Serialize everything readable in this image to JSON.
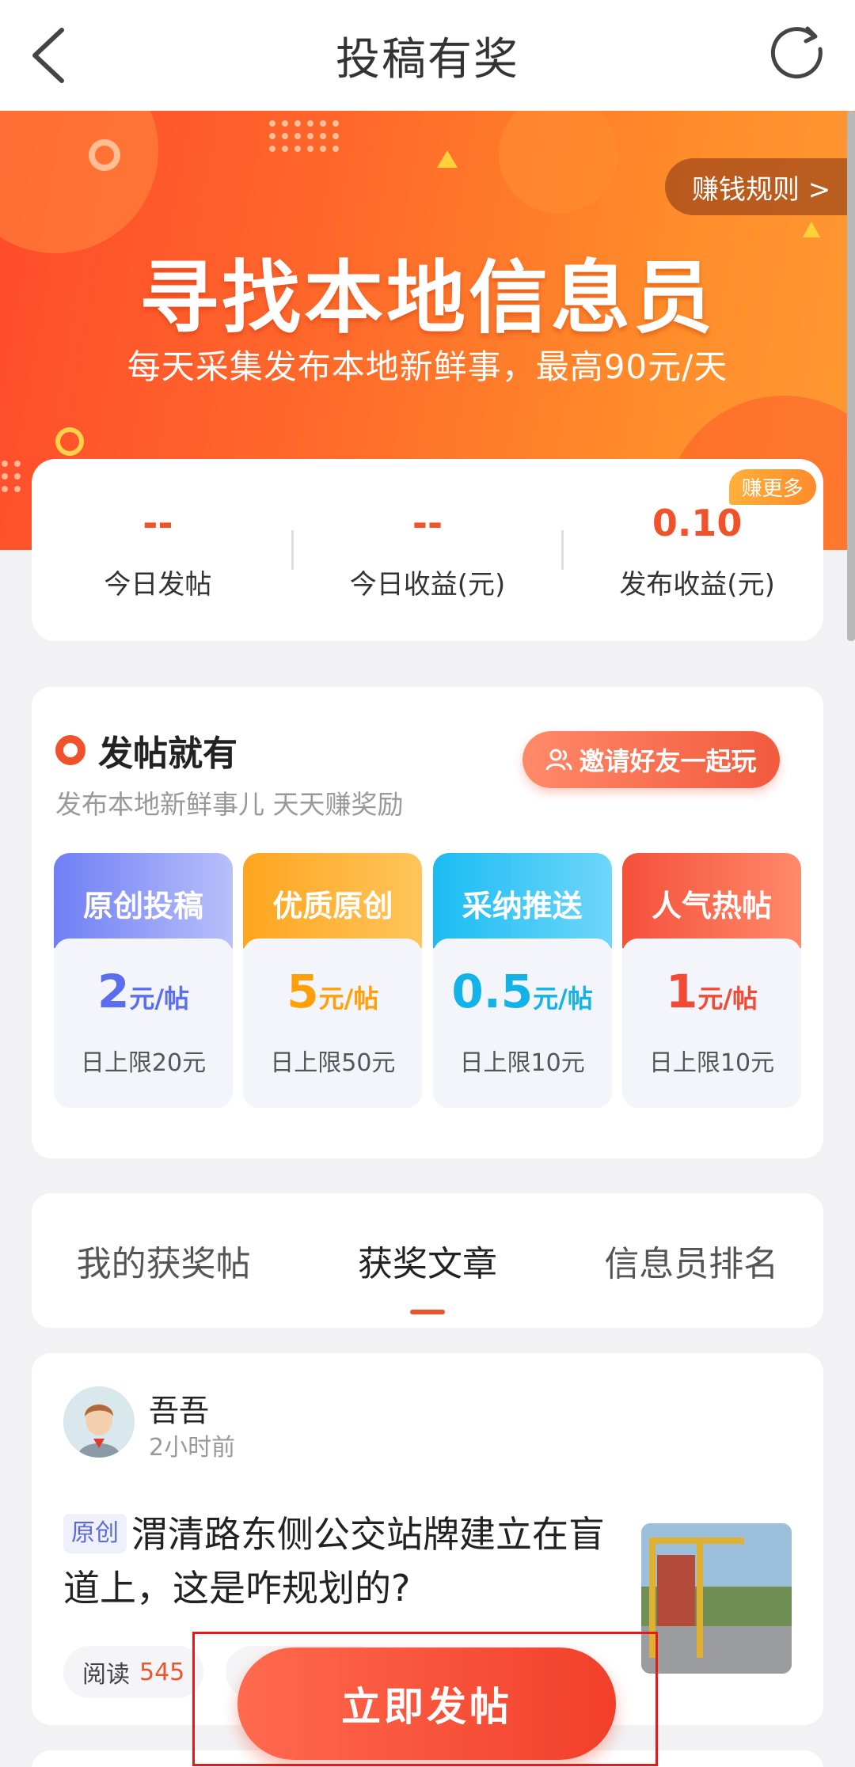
{
  "nav": {
    "title": "投稿有奖"
  },
  "banner": {
    "title": "寻找本地信息员",
    "subtitle": "每天采集发布本地新鲜事，最高90元/天",
    "rules_label": "赚钱规则 >"
  },
  "stats": [
    {
      "value": "--",
      "label": "今日发帖"
    },
    {
      "value": "--",
      "label": "今日收益(元)"
    },
    {
      "value": "0.10",
      "label": "发布收益(元)",
      "badge": "赚更多"
    }
  ],
  "reward": {
    "title": "发帖就有",
    "subtitle": "发布本地新鲜事儿 天天赚奖励",
    "invite_label": "邀请好友一起玩",
    "tiers": [
      {
        "name": "原创投稿",
        "amount": "2",
        "unit": "元/帖",
        "limit": "日上限20元",
        "color": "#5b6ef0",
        "head_from": "#6f7ff5",
        "head_to": "#b8c0fb"
      },
      {
        "name": "优质原创",
        "amount": "5",
        "unit": "元/帖",
        "limit": "日上限50元",
        "color": "#ff9f0a",
        "head_from": "#ffa51f",
        "head_to": "#ffc55a"
      },
      {
        "name": "采纳推送",
        "amount": "0.5",
        "unit": "元/帖",
        "limit": "日上限10元",
        "color": "#12b3e6",
        "head_from": "#1bbcf2",
        "head_to": "#6ed6fa"
      },
      {
        "name": "人气热帖",
        "amount": "1",
        "unit": "元/帖",
        "limit": "日上限10元",
        "color": "#f24a35",
        "head_from": "#f5503a",
        "head_to": "#ff8a6a"
      }
    ]
  },
  "tabs": [
    {
      "label": "我的获奖帖",
      "active": false
    },
    {
      "label": "获奖文章",
      "active": true
    },
    {
      "label": "信息员排名",
      "active": false
    }
  ],
  "post": {
    "author": "吾吾",
    "time": "2小时前",
    "tag": "原创",
    "title": "渭清路东侧公交站牌建立在盲道上，这是咋规划的?",
    "read_label": "阅读",
    "read_count": "545"
  },
  "cta": {
    "label": "立即发帖"
  },
  "colors": {
    "accent": "#f0522b"
  }
}
